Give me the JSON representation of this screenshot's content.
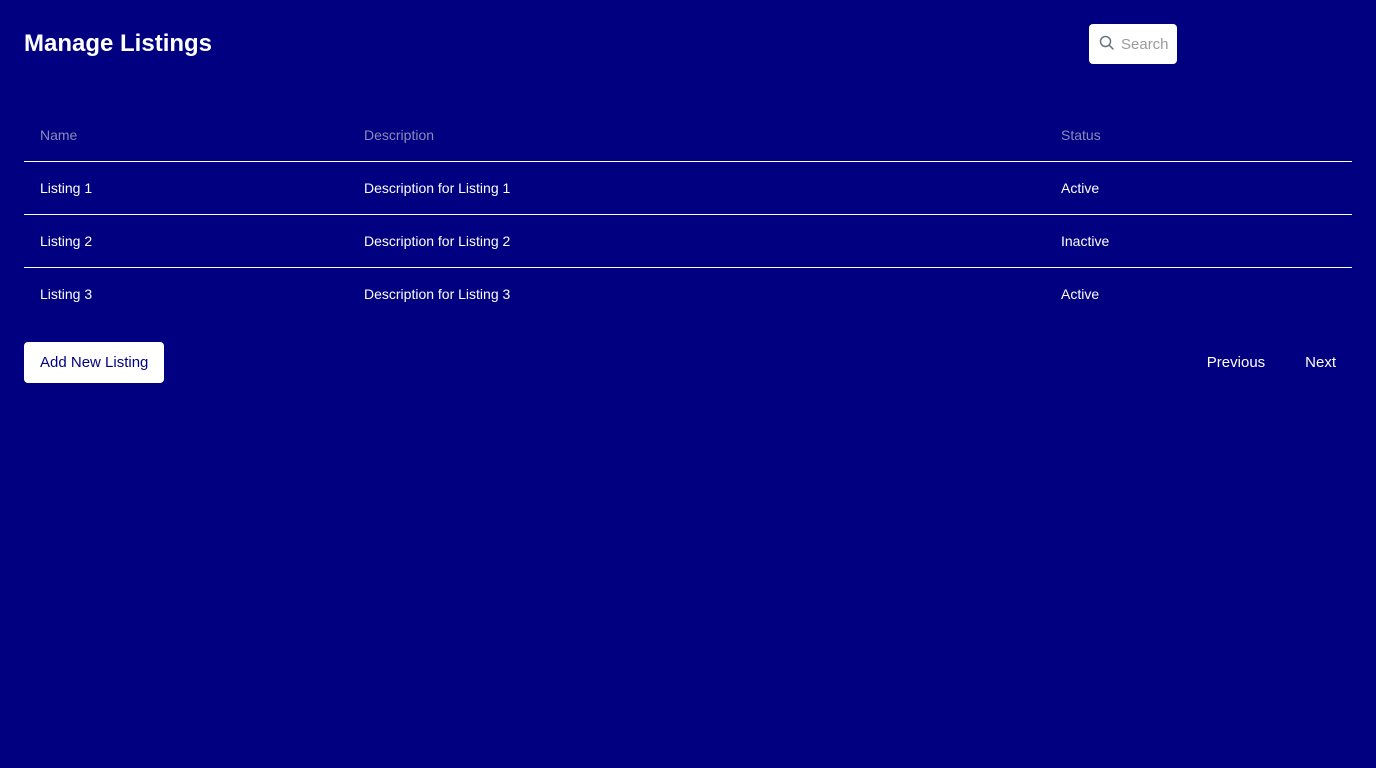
{
  "header": {
    "title": "Manage Listings"
  },
  "search": {
    "placeholder": "Search",
    "value": "",
    "icon": "search-icon"
  },
  "table": {
    "columns": [
      "Name",
      "Description",
      "Status"
    ],
    "rows": [
      {
        "name": "Listing 1",
        "description": "Description for Listing 1",
        "status": "Active"
      },
      {
        "name": "Listing 2",
        "description": "Description for Listing 2",
        "status": "Inactive"
      },
      {
        "name": "Listing 3",
        "description": "Description for Listing 3",
        "status": "Active"
      }
    ]
  },
  "actions": {
    "add_label": "Add New Listing"
  },
  "pagination": {
    "previous_label": "Previous",
    "next_label": "Next"
  },
  "colors": {
    "background": "#000080",
    "text": "#ffffff",
    "header_text": "#8a8ab8",
    "button_bg": "#ffffff",
    "button_text": "#000080"
  }
}
